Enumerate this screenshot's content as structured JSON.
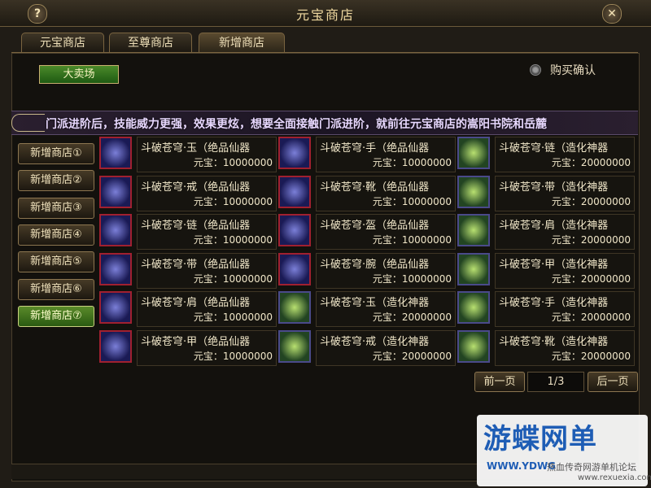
{
  "window": {
    "title": "元宝商店",
    "help": "?",
    "close": "✕"
  },
  "tabs": [
    "元宝商店",
    "至尊商店",
    "新增商店"
  ],
  "dama_label": "大卖场",
  "confirm_label": "购买确认",
  "marquee": "门派进阶后，技能威力更强，效果更炫，想要全面接触门派进阶，就前往元宝商店的嵩阳书院和岳麓",
  "side_items": [
    "新增商店①",
    "新增商店②",
    "新增商店③",
    "新增商店④",
    "新增商店⑤",
    "新增商店⑥",
    "新增商店⑦"
  ],
  "items": [
    {
      "name": "斗破苍穹·玉（绝品仙器",
      "price": "元宝：10000000"
    },
    {
      "name": "斗破苍穹·手（绝品仙器",
      "price": "元宝：10000000"
    },
    {
      "name": "斗破苍穹·链（造化神器",
      "price": "元宝：20000000"
    },
    {
      "name": "斗破苍穹·戒（绝品仙器",
      "price": "元宝：10000000"
    },
    {
      "name": "斗破苍穹·靴（绝品仙器",
      "price": "元宝：10000000"
    },
    {
      "name": "斗破苍穹·带（造化神器",
      "price": "元宝：20000000"
    },
    {
      "name": "斗破苍穹·链（绝品仙器",
      "price": "元宝：10000000"
    },
    {
      "name": "斗破苍穹·盔（绝品仙器",
      "price": "元宝：10000000"
    },
    {
      "name": "斗破苍穹·肩（造化神器",
      "price": "元宝：20000000"
    },
    {
      "name": "斗破苍穹·带（绝品仙器",
      "price": "元宝：10000000"
    },
    {
      "name": "斗破苍穹·腕（绝品仙器",
      "price": "元宝：10000000"
    },
    {
      "name": "斗破苍穹·甲（造化神器",
      "price": "元宝：20000000"
    },
    {
      "name": "斗破苍穹·肩（绝品仙器",
      "price": "元宝：10000000"
    },
    {
      "name": "斗破苍穹·玉（造化神器",
      "price": "元宝：20000000"
    },
    {
      "name": "斗破苍穹·手（造化神器",
      "price": "元宝：20000000"
    },
    {
      "name": "斗破苍穹·甲（绝品仙器",
      "price": "元宝：10000000"
    },
    {
      "name": "斗破苍穹·戒（造化神器",
      "price": "元宝：20000000"
    },
    {
      "name": "斗破苍穹·靴（造化神器",
      "price": "元宝：20000000"
    }
  ],
  "pagination": {
    "prev": "前一页",
    "page": "1/3",
    "next": "后一页"
  },
  "watermark": {
    "title": "游蝶网单",
    "url": "WWW.YDWG",
    "sub": "热血传奇网游单机论坛",
    "sub2": "www.rexuexia.com"
  }
}
